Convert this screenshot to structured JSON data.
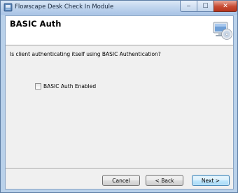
{
  "window": {
    "title": "Flowscape Desk Check In Module",
    "controls": {
      "minimize": "‒",
      "maximize": "☐",
      "close": "✕"
    }
  },
  "header": {
    "title": "BASIC Auth",
    "icon": "computer-disc-icon"
  },
  "content": {
    "question": "Is client authenticating itself using BASIC Authentication?",
    "checkbox": {
      "label": "BASIC Auth Enabled",
      "checked": false
    }
  },
  "buttons": {
    "cancel": "Cancel",
    "back": "< Back",
    "next": "Next >"
  },
  "colors": {
    "accent": "#3c7fb1",
    "frame": "#b9d1ea",
    "close": "#c74b33"
  }
}
